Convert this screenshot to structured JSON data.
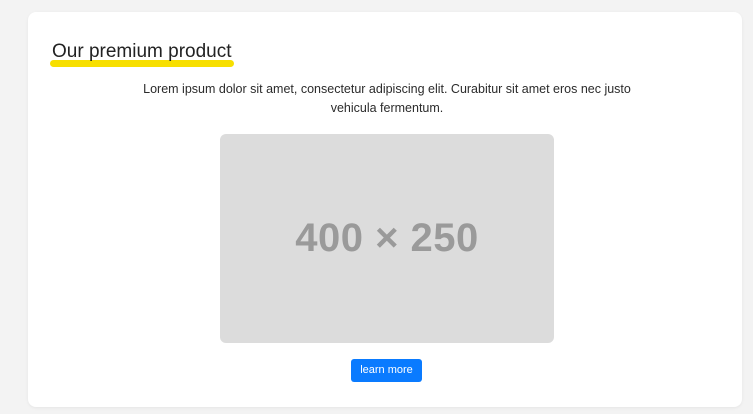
{
  "card": {
    "title": "Our premium product",
    "description": "Lorem ipsum dolor sit amet, consectetur adipiscing elit. Curabitur sit amet eros nec justo vehicula fermentum.",
    "image_placeholder": "400 × 250",
    "button_label": "learn more"
  },
  "colors": {
    "page_background": "#f3f3f3",
    "card_background": "#ffffff",
    "accent_underline": "#f7df00",
    "placeholder_background": "#dcdcdc",
    "placeholder_text": "#9a9a9a",
    "button_background": "#0a7bff",
    "button_text": "#ffffff"
  }
}
